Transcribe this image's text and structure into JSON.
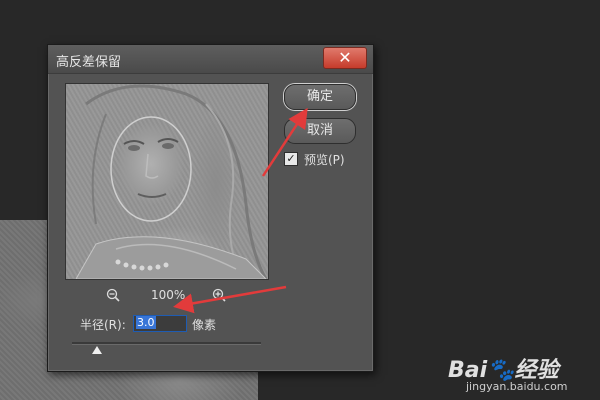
{
  "dialog": {
    "title": "高反差保留",
    "close_glyph": "✕",
    "buttons": {
      "ok": "确定",
      "cancel": "取消"
    },
    "preview_option": {
      "label": "预览(P)",
      "checked": true
    },
    "zoom": {
      "level": "100%",
      "zoom_out_icon": "zoom-out-icon",
      "zoom_in_icon": "zoom-in-icon"
    },
    "radius": {
      "label": "半径(R):",
      "value": "3.0",
      "unit": "像素"
    },
    "slider": {
      "fraction": 0.13
    }
  },
  "annotations": {
    "arrow_color": "#e23b3b"
  },
  "watermark": {
    "brand": "Bai🐾经验",
    "url": "jingyan.baidu.com"
  }
}
